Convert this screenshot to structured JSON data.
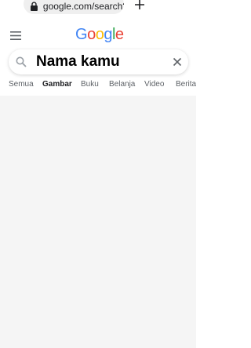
{
  "browser": {
    "url": "google.com/search?q",
    "lock_icon": "lock-icon",
    "new_tab_icon": "plus-icon"
  },
  "header": {
    "menu_icon": "hamburger-menu-icon",
    "logo_letters": [
      {
        "char": "G",
        "color": "#4285F4"
      },
      {
        "char": "o",
        "color": "#EA4335"
      },
      {
        "char": "o",
        "color": "#FBBC05"
      },
      {
        "char": "g",
        "color": "#4285F4"
      },
      {
        "char": "l",
        "color": "#34A853"
      },
      {
        "char": "e",
        "color": "#EA4335"
      }
    ]
  },
  "search": {
    "value": "Nama kamu",
    "search_icon": "search-icon",
    "clear_icon": "close-icon"
  },
  "tabs": {
    "items": [
      {
        "label": "Semua"
      },
      {
        "label": "Gambar"
      },
      {
        "label": "Buku"
      },
      {
        "label": "Belanja"
      },
      {
        "label": "Video"
      },
      {
        "label": "Berita"
      }
    ],
    "active": "Gambar"
  }
}
